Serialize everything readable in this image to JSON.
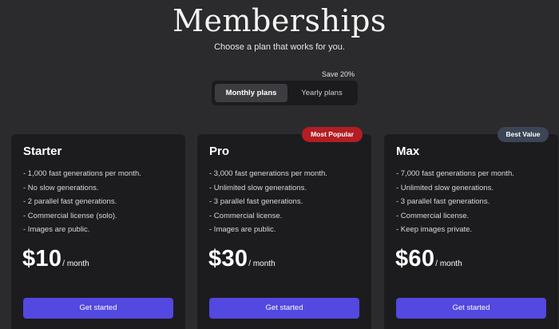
{
  "header": {
    "title": "Memberships",
    "subtitle": "Choose a plan that works for you.",
    "save_note": "Save 20%"
  },
  "billing_toggle": {
    "monthly_label": "Monthly plans",
    "yearly_label": "Yearly plans",
    "selected": "Monthly plans"
  },
  "badges": {
    "popular": "Most Popular",
    "value": "Best Value"
  },
  "plans": [
    {
      "name": "Starter",
      "features": [
        "- 1,000 fast generations per month.",
        "- No slow generations.",
        "- 2 parallel fast generations.",
        "- Commercial license (solo).",
        "- Images are public."
      ],
      "price": "$10",
      "period": "/ month",
      "cta": "Get started"
    },
    {
      "name": "Pro",
      "features": [
        "- 3,000 fast generations per month.",
        "- Unlimited slow generations.",
        "- 3 parallel fast generations.",
        "- Commercial license.",
        "- Images are public."
      ],
      "price": "$30",
      "period": "/ month",
      "cta": "Get started"
    },
    {
      "name": "Max",
      "features": [
        "- 7,000 fast generations per month.",
        "- Unlimited slow generations.",
        "- 3 parallel fast generations.",
        "- Commercial license.",
        "- Keep images private."
      ],
      "price": "$60",
      "period": "/ month",
      "cta": "Get started"
    }
  ],
  "colors": {
    "background": "#2b2b2d",
    "card": "#1c1c1e",
    "cta": "#5348e0",
    "popular_badge": "#b31d23",
    "value_badge": "#3b4556"
  }
}
